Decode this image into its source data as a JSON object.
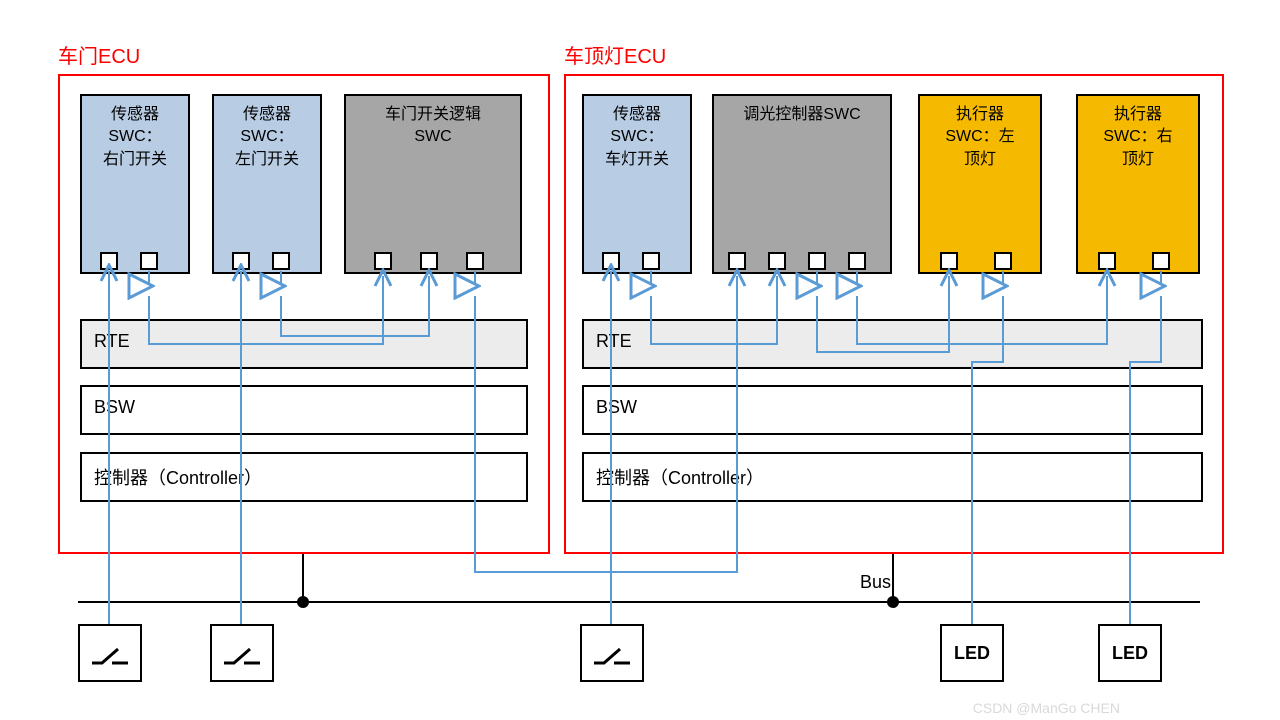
{
  "ecu1": {
    "title": "车门ECU",
    "swc": {
      "rightDoor": "传感器\nSWC：\n右门开关",
      "leftDoor": "传感器\nSWC：\n左门开关",
      "doorLogic": "车门开关逻辑\nSWC"
    },
    "rte": "RTE",
    "bsw": "BSW",
    "controller": "控制器（Controller）"
  },
  "ecu2": {
    "title": "车顶灯ECU",
    "swc": {
      "lampSwitch": "传感器\nSWC：\n车灯开关",
      "dimmer": "调光控制器SWC",
      "leftLamp": "执行器\nSWC：左\n顶灯",
      "rightLamp": "执行器\nSWC：右\n顶灯"
    },
    "rte": "RTE",
    "bsw": "BSW",
    "controller": "控制器（Controller）"
  },
  "bus": "Bus",
  "led": "LED",
  "watermark": "CSDN @ManGo CHEN",
  "colors": {
    "frame": "#ff0000",
    "swcBlue": "#b8cce4",
    "swcGray": "#a6a6a6",
    "swcOrange": "#f5b900",
    "connector": "#5b9bd5"
  }
}
